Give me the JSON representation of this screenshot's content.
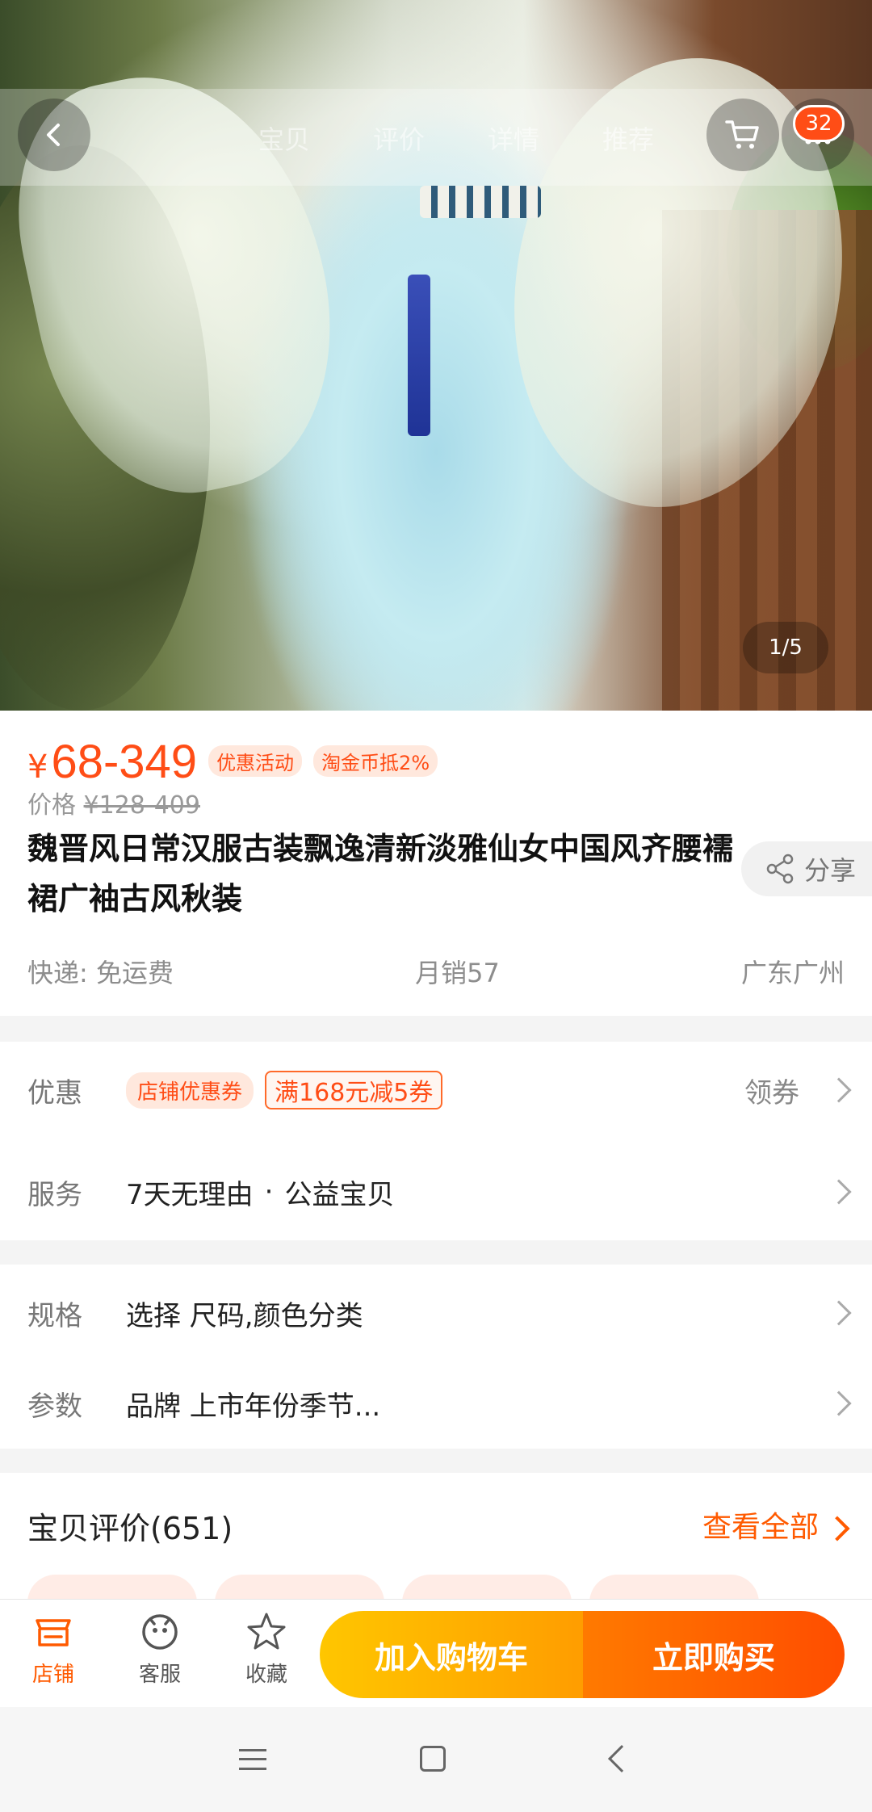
{
  "hero": {
    "image_counter": "1/5",
    "cart_badge": "32",
    "tabs": [
      "宝贝",
      "评价",
      "详情",
      "推荐"
    ]
  },
  "price": {
    "symbol": "¥",
    "value": "68-349",
    "tags": [
      "优惠活动",
      "淘金币抵2%"
    ],
    "original_label": "价格",
    "original_value": "¥128-409"
  },
  "title": "魏晋风日常汉服古装飘逸清新淡雅仙女中国风齐腰襦裙广袖古风秋装",
  "share_label": "分享",
  "meta": {
    "shipping": "快递: 免运费",
    "monthly_sales": "月销57",
    "location": "广东广州"
  },
  "promo": {
    "label": "优惠",
    "chip": "店铺优惠券",
    "coupon": "满168元减5券",
    "action": "领券"
  },
  "service": {
    "label": "服务",
    "items": [
      "7天无理由",
      "·",
      "公益宝贝"
    ]
  },
  "spec": {
    "label": "规格",
    "value": "选择 尺码,颜色分类"
  },
  "params": {
    "label": "参数",
    "value": "品牌 上市年份季节..."
  },
  "reviews": {
    "title": "宝贝评价(651)",
    "view_all": "查看全部"
  },
  "actions": {
    "store": "店铺",
    "service": "客服",
    "favorite": "收藏",
    "add_to_cart": "加入购物车",
    "buy_now": "立即购买"
  },
  "colors": {
    "accent": "#ff4d16",
    "cart_gradient": [
      "#ffc600",
      "#ff9d00"
    ],
    "buy_gradient": [
      "#ff7a00",
      "#ff4d00"
    ]
  }
}
